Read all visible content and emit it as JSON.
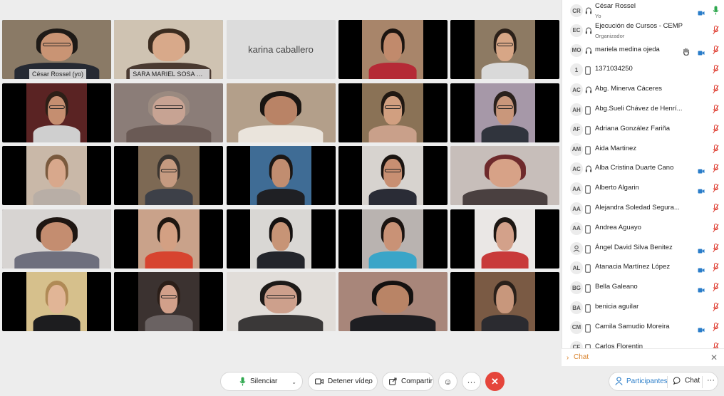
{
  "grid": {
    "tiles": [
      {
        "name": "César Rossel  (yo)",
        "selected": true,
        "bg": "#6b5a48",
        "wall": "#8a7a66",
        "skin": "#c99474",
        "hair": "#1e1a17",
        "cloth": "#262a33",
        "glasses": true,
        "mode": "full"
      },
      {
        "name": "SARA MARIEL SOSA VIL...",
        "selected": true,
        "bg": "#5a4a3d",
        "wall": "#cfc3b2",
        "skin": "#d8a98a",
        "hair": "#3b2c20",
        "cloth": "#4a3a31",
        "glasses": false,
        "mode": "full"
      },
      {
        "name": "karina caballero",
        "blank": true
      },
      {
        "name": "",
        "bg": "#000000",
        "wall": "#a8856a",
        "skin": "#c18a6c",
        "hair": "#1b1410",
        "cloth": "#b52a36",
        "glasses": false,
        "mode": "center"
      },
      {
        "name": "",
        "bg": "#000000",
        "wall": "#8d7a63",
        "skin": "#d7a686",
        "hair": "#2b2019",
        "cloth": "#d9d9d9",
        "glasses": true,
        "mode": "center"
      },
      {
        "name": "",
        "bg": "#000000",
        "wall": "#5a2323",
        "skin": "#c58e70",
        "hair": "#2d1f17",
        "cloth": "#cfcfcf",
        "glasses": true,
        "mode": "center"
      },
      {
        "name": "",
        "bg": "#7a6a63",
        "wall": "#8b7d78",
        "skin": "#c7a393",
        "hair": "#9a8a80",
        "cloth": "#6a5a55",
        "glasses": true,
        "mode": "full"
      },
      {
        "name": "",
        "bg": "#5d4b3d",
        "wall": "#b39f8a",
        "skin": "#b98366",
        "hair": "#1a1512",
        "cloth": "#eae4dc",
        "glasses": false,
        "mode": "full"
      },
      {
        "name": "",
        "bg": "#000000",
        "wall": "#8a7256",
        "skin": "#d19f80",
        "hair": "#201812",
        "cloth": "#c9a08a",
        "glasses": true,
        "mode": "center"
      },
      {
        "name": "",
        "bg": "#000000",
        "wall": "#a698a8",
        "skin": "#c9977b",
        "hair": "#2a211c",
        "cloth": "#30343d",
        "glasses": true,
        "mode": "center"
      },
      {
        "name": "",
        "bg": "#000000",
        "wall": "#c9b8a8",
        "skin": "#d8a88c",
        "hair": "#7a5a3e",
        "cloth": "#b8aea6",
        "glasses": false,
        "mode": "center"
      },
      {
        "name": "",
        "bg": "#000000",
        "wall": "#7d6954",
        "skin": "#c59a80",
        "hair": "#3b3530",
        "cloth": "#3d4048",
        "glasses": true,
        "mode": "center"
      },
      {
        "name": "",
        "bg": "#000000",
        "wall": "#3f6c95",
        "skin": "#c18d70",
        "hair": "#1c1714",
        "cloth": "#1f2024",
        "glasses": false,
        "mode": "center"
      },
      {
        "name": "",
        "bg": "#000000",
        "wall": "#d7d3cf",
        "skin": "#c88f72",
        "hair": "#1a1411",
        "cloth": "#2a2c36",
        "glasses": true,
        "mode": "center"
      },
      {
        "name": "",
        "bg": "#b0a6a3",
        "wall": "#c7beba",
        "skin": "#d7a287",
        "hair": "#6e2a2c",
        "cloth": "#4a4040",
        "glasses": false,
        "mode": "full"
      },
      {
        "name": "",
        "bg": "#3c3b44",
        "wall": "#d7d4d2",
        "skin": "#c48d70",
        "hair": "#1e1612",
        "cloth": "#6e6f7d",
        "glasses": false,
        "mode": "full"
      },
      {
        "name": "",
        "bg": "#000000",
        "wall": "#c9a28a",
        "skin": "#d3a083",
        "hair": "#1e1610",
        "cloth": "#d7442f",
        "glasses": false,
        "mode": "center"
      },
      {
        "name": "",
        "bg": "#000000",
        "wall": "#d9d7d4",
        "skin": "#c79476",
        "hair": "#141110",
        "cloth": "#23252b",
        "glasses": false,
        "mode": "center"
      },
      {
        "name": "",
        "bg": "#000000",
        "wall": "#b9b3b0",
        "skin": "#c99276",
        "hair": "#1a1310",
        "cloth": "#3aa5c8",
        "glasses": false,
        "mode": "center"
      },
      {
        "name": "",
        "bg": "#000000",
        "wall": "#eae7e5",
        "skin": "#d3a18a",
        "hair": "#1d1713",
        "cloth": "#c83a3a",
        "glasses": false,
        "mode": "center"
      },
      {
        "name": "",
        "bg": "#000000",
        "wall": "#d6c08c",
        "skin": "#e1b596",
        "hair": "#b08a56",
        "cloth": "#1d1d1f",
        "glasses": false,
        "mode": "center"
      },
      {
        "name": "",
        "bg": "#000000",
        "wall": "#3b3230",
        "skin": "#d2a08a",
        "hair": "#2b1e18",
        "cloth": "#6a6262",
        "glasses": true,
        "mode": "center"
      },
      {
        "name": "",
        "bg": "#c9c3bf",
        "wall": "#e1ddd9",
        "skin": "#cda08c",
        "hair": "#1d1a18",
        "cloth": "#3a3838",
        "glasses": true,
        "mode": "full"
      },
      {
        "name": "",
        "bg": "#8a6256",
        "wall": "#a8867a",
        "skin": "#b98466",
        "hair": "#141110",
        "cloth": "#1e1e22",
        "glasses": false,
        "mode": "full"
      },
      {
        "name": "",
        "bg": "#000000",
        "wall": "#7a5a44",
        "skin": "#c8977c",
        "hair": "#2a201a",
        "cloth": "#2b2b30",
        "glasses": false,
        "mode": "center"
      }
    ]
  },
  "participants": {
    "rows": [
      {
        "initials": "CR",
        "device": "headset",
        "name": "César Rossel",
        "sub": "Yo",
        "cam": true,
        "mic": "on"
      },
      {
        "initials": "EC",
        "device": "headset",
        "name": "Ejecución de Cursos - CEMP",
        "sub": "Organizador",
        "cam": false,
        "mic": "off"
      },
      {
        "initials": "MO",
        "device": "headset",
        "name": "mariela medina ojeda",
        "sub": "",
        "cam": true,
        "mic": "off",
        "hand": true
      },
      {
        "initials": "1",
        "device": "phone",
        "name": "1371034250",
        "sub": "",
        "cam": false,
        "mic": "off"
      },
      {
        "initials": "AC",
        "device": "headset",
        "name": "Abg. Minerva Cáceres",
        "sub": "",
        "cam": false,
        "mic": "off"
      },
      {
        "initials": "AH",
        "device": "phone",
        "name": "Abg.Sueli Chávez de Henrí...",
        "sub": "",
        "cam": false,
        "mic": "off"
      },
      {
        "initials": "AF",
        "device": "phone",
        "name": "Adriana González Fariña",
        "sub": "",
        "cam": false,
        "mic": "off"
      },
      {
        "initials": "AM",
        "device": "phone",
        "name": "Aida Martinez",
        "sub": "",
        "cam": false,
        "mic": "off"
      },
      {
        "initials": "AC",
        "device": "headset",
        "name": "Alba Cristina Duarte Cano",
        "sub": "",
        "cam": true,
        "mic": "off"
      },
      {
        "initials": "AA",
        "device": "phone",
        "name": "Alberto Algarin",
        "sub": "",
        "cam": true,
        "mic": "off"
      },
      {
        "initials": "AA",
        "device": "phone",
        "name": "Alejandra Soledad Segura...",
        "sub": "",
        "cam": false,
        "mic": "off"
      },
      {
        "initials": "AA",
        "device": "phone",
        "name": "Andrea Aguayo",
        "sub": "",
        "cam": false,
        "mic": "off"
      },
      {
        "initials": "",
        "device": "phone",
        "name": "Ángel David Silva Benitez",
        "sub": "",
        "cam": true,
        "mic": "off",
        "person_avatar": true
      },
      {
        "initials": "AL",
        "device": "phone",
        "name": "Atanacia Martínez López",
        "sub": "",
        "cam": true,
        "mic": "off"
      },
      {
        "initials": "BG",
        "device": "phone",
        "name": "Bella Galeano",
        "sub": "",
        "cam": true,
        "mic": "off"
      },
      {
        "initials": "BA",
        "device": "phone",
        "name": "benicia aguilar",
        "sub": "",
        "cam": false,
        "mic": "off"
      },
      {
        "initials": "CM",
        "device": "phone",
        "name": "Camila Samudio Moreira",
        "sub": "",
        "cam": true,
        "mic": "off"
      },
      {
        "initials": "CF",
        "device": "phone",
        "name": "Carlos Florentin",
        "sub": "",
        "cam": false,
        "mic": "off"
      }
    ],
    "chat_label": "Chat"
  },
  "controls": {
    "mute_label": "Silenciar",
    "video_label": "Detener vídeo",
    "share_label": "Compartir",
    "participants_label": "Participantes",
    "chat_label": "Chat"
  },
  "colors": {
    "accent": "#3aa8d8",
    "end_call": "#e5453b",
    "mic_on": "#2fa84f",
    "mic_off": "#e0463a",
    "chat": "#d9822b",
    "link": "#2a7dc9"
  }
}
